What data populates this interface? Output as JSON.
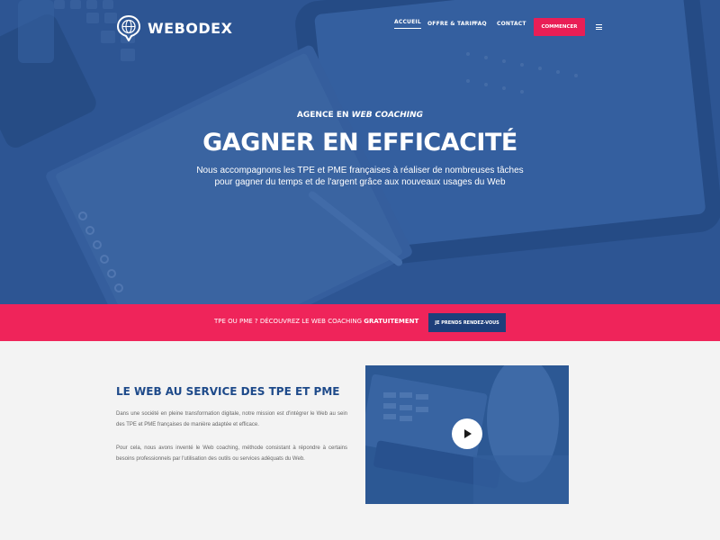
{
  "brand": {
    "name": "WEBODEX",
    "icon": "globe-pin-icon"
  },
  "nav": {
    "items": [
      {
        "label": "ACCUEIL",
        "active": true
      },
      {
        "label": "OFFRE & TARIF",
        "active": false
      },
      {
        "label": "FAQ",
        "active": false
      },
      {
        "label": "CONTACT",
        "active": false
      }
    ],
    "cta_label": "COMMENCER",
    "menu_icon": "hamburger-icon"
  },
  "hero": {
    "kicker_prefix": "AGENCE EN",
    "kicker_emphasis": "WEB COACHING",
    "headline": "GAGNER EN EFFICACITÉ",
    "subtitle_line1": "Nous accompagnons les TPE et PME françaises à réaliser de nombreuses tâches",
    "subtitle_line2": "pour gagner du temps et de l'argent grâce aux nouveaux usages du Web"
  },
  "banner": {
    "text": "TPE OU PME ? DÉCOUVREZ LE WEB COACHING",
    "emphasis": "GRATUITEMENT",
    "button_label": "JE PRENDS RENDEZ-VOUS"
  },
  "content": {
    "title": "LE WEB AU SERVICE DES TPE ET PME",
    "paragraph1": "Dans une société en pleine transformation digitale, notre mission est d'intégrer le Web au sein des TPE et PME françaises de manière adaptée et efficace.",
    "paragraph2": "Pour cela, nous avons inventé le Web coaching, méthode consistant à répondre à certains besoins professionnels par l'utilisation des outils ou services adéquats du Web.",
    "video_icon": "play-icon"
  },
  "colors": {
    "hero_blue": "#2c5591",
    "accent_pink": "#ef245a",
    "dark_blue": "#1e3f7b",
    "title_blue": "#1e4a8a"
  }
}
